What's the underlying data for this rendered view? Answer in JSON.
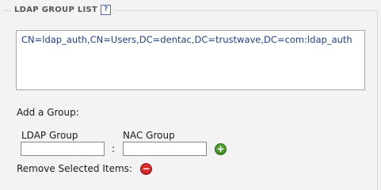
{
  "section": {
    "title": "LDAP GROUP LIST",
    "help_icon": "?"
  },
  "group_list": {
    "items": [
      "CN=ldap_auth,CN=Users,DC=dentac,DC=trustwave,DC=com:ldap_auth"
    ]
  },
  "add_group": {
    "label": "Add a Group:",
    "ldap_label": "LDAP Group",
    "nac_label": "NAC Group",
    "separator": ":",
    "ldap_value": "",
    "nac_value": "",
    "add_icon": "+"
  },
  "remove": {
    "label": "Remove Selected Items:",
    "remove_icon": "−"
  },
  "colors": {
    "add_button": "#4f9e2e",
    "remove_button": "#d92b2b",
    "list_text": "#1f3f86"
  }
}
